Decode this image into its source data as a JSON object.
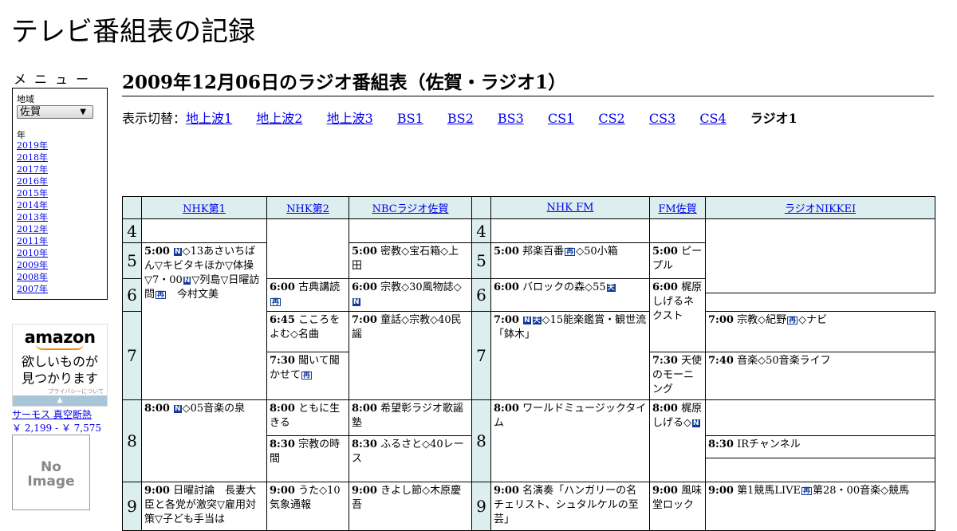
{
  "site_title": "テレビ番組表の記録",
  "menu": {
    "heading": "メニュー",
    "region_label": "地域",
    "region_value": "佐賀",
    "year_label": "年",
    "years": [
      "2019年",
      "2018年",
      "2017年",
      "2016年",
      "2015年",
      "2014年",
      "2013年",
      "2012年",
      "2011年",
      "2010年",
      "2009年",
      "2008年",
      "2007年"
    ]
  },
  "ad": {
    "brand": "amazon",
    "tagline_1": "欲しいものが",
    "tagline_2": "見つかります",
    "privacy": "プライバシーについて",
    "product_name": "サーモス 真空断熱",
    "product_price": "￥ 2,199 - ￥ 7,575",
    "noimage_1": "No",
    "noimage_2": "Image"
  },
  "page_heading": "2009年12月06日のラジオ番組表（佐賀・ラジオ1）",
  "switcher": {
    "prefix": "表示切替：",
    "links": [
      "地上波1",
      "地上波2",
      "地上波3",
      "BS1",
      "BS2",
      "BS3",
      "CS1",
      "CS2",
      "CS3",
      "CS4"
    ],
    "current": "ラジオ1"
  },
  "channels": [
    "NHK第1",
    "NHK第2",
    "NBCラジオ佐賀",
    "NHK FM",
    "FM佐賀",
    "ラジオNIKKEI"
  ],
  "hours": [
    "4",
    "5",
    "6",
    "7",
    "8",
    "9"
  ],
  "programs": {
    "nhk1_0500": {
      "time": "5:00",
      "b1": "N",
      "text": "◇13あさいちばん▽キビタキほか▽体操▽7・00",
      "b2": "N",
      "text2": "▽列島▽日曜訪問",
      "b3": "再",
      "text3": "　今村文美"
    },
    "nhk1_0800": {
      "time": "8:00",
      "b1": "N",
      "text": "◇05音楽の泉"
    },
    "nhk1_0900": {
      "time": "9:00",
      "text": "日曜討論　長妻大臣と各党が激突▽雇用対策▽子ども手当は"
    },
    "nhk2_0600": {
      "time": "6:00",
      "text": "古典講読",
      "b1": "再"
    },
    "nhk2_0645": {
      "time": "6:45",
      "text": "こころをよむ◇名曲"
    },
    "nhk2_0730": {
      "time": "7:30",
      "text": "聞いて聞かせて",
      "b1": "再"
    },
    "nhk2_0800": {
      "time": "8:00",
      "text": "ともに生きる"
    },
    "nhk2_0830": {
      "time": "8:30",
      "text": "宗教の時間"
    },
    "nhk2_0900": {
      "time": "9:00",
      "text": "うた◇10気象通報"
    },
    "nbc_0500": {
      "time": "5:00",
      "text": "密教◇宝石箱◇上田"
    },
    "nbc_0600": {
      "time": "6:00",
      "text": "宗教◇30風物誌◇",
      "b1": "N"
    },
    "nbc_0700": {
      "time": "7:00",
      "text": "童話◇宗教◇40民謡"
    },
    "nbc_0800": {
      "time": "8:00",
      "text": "希望彰ラジオ歌謡塾"
    },
    "nbc_0830": {
      "time": "8:30",
      "text": "ふるさと◇40レース"
    },
    "nbc_0900": {
      "time": "9:00",
      "text": "きよし節◇木原慶吾"
    },
    "fm_0500": {
      "time": "5:00",
      "text": "邦楽百番",
      "b1": "再",
      "text2": "◇50小箱"
    },
    "fm_0600": {
      "time": "6:00",
      "text": "バロックの森◇55",
      "b1": "天"
    },
    "fm_0700": {
      "time": "7:00",
      "b1": "N",
      "b2": "天",
      "text": "◇15能楽鑑賞・観世流「鉢木」"
    },
    "fm_0800": {
      "time": "8:00",
      "text": "ワールドミュージックタイム"
    },
    "fm_0900": {
      "time": "9:00",
      "text": "名演奏「ハンガリーの名チェリスト、シュタルケルの至芸」"
    },
    "fmsaga_0500": {
      "time": "5:00",
      "text": "ピープル"
    },
    "fmsaga_0600": {
      "time": "6:00",
      "text": "梶原しげるネクスト"
    },
    "fmsaga_0730": {
      "time": "7:30",
      "text": "天使のモーニング"
    },
    "fmsaga_0800": {
      "time": "8:00",
      "text": "梶原しげる◇",
      "b1": "N"
    },
    "fmsaga_0900": {
      "time": "9:00",
      "text": "風味堂ロック"
    },
    "nikkei_0700": {
      "time": "7:00",
      "text": "宗教◇紀野",
      "b1": "再",
      "text2": "◇ナビ"
    },
    "nikkei_0740": {
      "time": "7:40",
      "text": "音楽◇50音楽ライフ"
    },
    "nikkei_0830": {
      "time": "8:30",
      "text": "IRチャンネル"
    },
    "nikkei_0900": {
      "time": "9:00",
      "text": "第1競馬LIVE",
      "b1": "再",
      "text2": "第28・00音楽◇競馬"
    }
  }
}
